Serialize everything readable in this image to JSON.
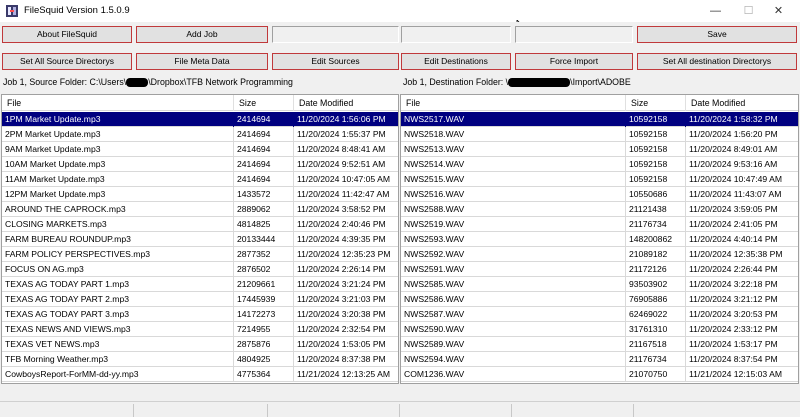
{
  "window": {
    "title": "FileSquid Version 1.5.0.9",
    "minimize": "—",
    "maximize": "☐",
    "close": "✕"
  },
  "toolbar": {
    "about": "About FileSquid",
    "add_job": "Add Job",
    "save": "Save",
    "set_source_dirs": "Set All Source Directorys",
    "file_meta": "File Meta Data",
    "edit_sources": "Edit Sources",
    "edit_destinations": "Edit Destinations",
    "force_import": "Force Import",
    "set_dest_dirs": "Set All destination Directorys"
  },
  "source": {
    "folder_prefix": "Job 1, Source Folder: C:\\Users\\",
    "folder_suffix": "\\Dropbox\\TFB Network Programming",
    "columns": [
      "File",
      "Size",
      "Date Modified"
    ],
    "rows": [
      [
        "1PM Market Update.mp3",
        "2414694",
        "11/20/2024 1:56:06 PM"
      ],
      [
        "2PM Market Update.mp3",
        "2414694",
        "11/20/2024 1:55:37 PM"
      ],
      [
        "9AM Market Update.mp3",
        "2414694",
        "11/20/2024 8:48:41 AM"
      ],
      [
        "10AM Market Update.mp3",
        "2414694",
        "11/20/2024 9:52:51 AM"
      ],
      [
        "11AM Market Update.mp3",
        "2414694",
        "11/20/2024 10:47:05 AM"
      ],
      [
        "12PM Market Update.mp3",
        "1433572",
        "11/20/2024 11:42:47 AM"
      ],
      [
        "AROUND THE CAPROCK.mp3",
        "2889062",
        "11/20/2024 3:58:52 PM"
      ],
      [
        "CLOSING MARKETS.mp3",
        "4814825",
        "11/20/2024 2:40:46 PM"
      ],
      [
        "FARM BUREAU ROUNDUP.mp3",
        "20133444",
        "11/20/2024 4:39:35 PM"
      ],
      [
        "FARM POLICY PERSPECTIVES.mp3",
        "2877352",
        "11/20/2024 12:35:23 PM"
      ],
      [
        "FOCUS ON AG.mp3",
        "2876502",
        "11/20/2024 2:26:14 PM"
      ],
      [
        "TEXAS AG TODAY PART 1.mp3",
        "21209661",
        "11/20/2024 3:21:24 PM"
      ],
      [
        "TEXAS AG TODAY PART 2.mp3",
        "17445939",
        "11/20/2024 3:21:03 PM"
      ],
      [
        "TEXAS AG TODAY PART 3.mp3",
        "14172273",
        "11/20/2024 3:20:38 PM"
      ],
      [
        "TEXAS NEWS AND VIEWS.mp3",
        "7214955",
        "11/20/2024 2:32:54 PM"
      ],
      [
        "TEXAS VET NEWS.mp3",
        "2875876",
        "11/20/2024 1:53:05 PM"
      ],
      [
        "TFB Morning Weather.mp3",
        "4804925",
        "11/20/2024 8:37:38 PM"
      ],
      [
        "CowboysReport-ForMM-dd-yy.mp3",
        "4775364",
        "11/21/2024 12:13:25 AM"
      ]
    ]
  },
  "destination": {
    "folder_prefix": "Job 1, Destination Folder: \\",
    "folder_suffix": "\\Import\\ADOBE",
    "columns": [
      "File",
      "Size",
      "Date Modified"
    ],
    "rows": [
      [
        "NWS2517.WAV",
        "10592158",
        "11/20/2024 1:58:32 PM"
      ],
      [
        "NWS2518.WAV",
        "10592158",
        "11/20/2024 1:56:20 PM"
      ],
      [
        "NWS2513.WAV",
        "10592158",
        "11/20/2024 8:49:01 AM"
      ],
      [
        "NWS2514.WAV",
        "10592158",
        "11/20/2024 9:53:16 AM"
      ],
      [
        "NWS2515.WAV",
        "10592158",
        "11/20/2024 10:47:49 AM"
      ],
      [
        "NWS2516.WAV",
        "10550686",
        "11/20/2024 11:43:07 AM"
      ],
      [
        "NWS2588.WAV",
        "21121438",
        "11/20/2024 3:59:05 PM"
      ],
      [
        "NWS2519.WAV",
        "21176734",
        "11/20/2024 2:41:05 PM"
      ],
      [
        "NWS2593.WAV",
        "148200862",
        "11/20/2024 4:40:14 PM"
      ],
      [
        "NWS2592.WAV",
        "21089182",
        "11/20/2024 12:35:38 PM"
      ],
      [
        "NWS2591.WAV",
        "21172126",
        "11/20/2024 2:26:44 PM"
      ],
      [
        "NWS2585.WAV",
        "93503902",
        "11/20/2024 3:22:18 PM"
      ],
      [
        "NWS2586.WAV",
        "76905886",
        "11/20/2024 3:21:12 PM"
      ],
      [
        "NWS2587.WAV",
        "62469022",
        "11/20/2024 3:20:53 PM"
      ],
      [
        "NWS2590.WAV",
        "31761310",
        "11/20/2024 2:33:12 PM"
      ],
      [
        "NWS2589.WAV",
        "21167518",
        "11/20/2024 1:53:17 PM"
      ],
      [
        "NWS2594.WAV",
        "21176734",
        "11/20/2024 8:37:54 PM"
      ],
      [
        "COM1236.WAV",
        "21070750",
        "11/21/2024 12:15:03 AM"
      ]
    ]
  },
  "colors": {
    "selection": "#000080",
    "button_border": "#c0393b",
    "button_face": "#e1e1e1"
  }
}
